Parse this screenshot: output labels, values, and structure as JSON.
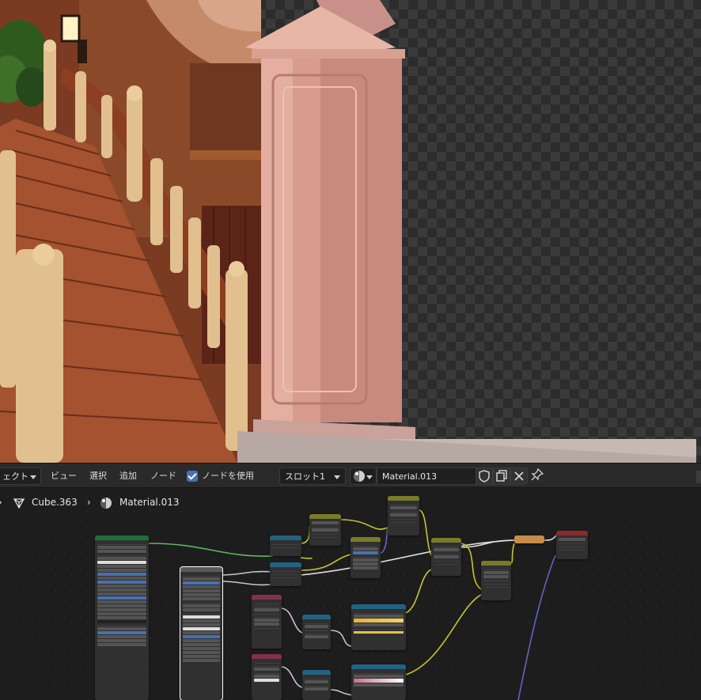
{
  "header": {
    "editor_mode": "ェクト",
    "menu": [
      "ビュー",
      "選択",
      "追加",
      "ノード"
    ],
    "use_nodes_label": "ノードを使用",
    "slot": "スロット1",
    "material_name": "Material.013"
  },
  "breadcrumb": {
    "object": "Cube.363",
    "material": "Material.013"
  },
  "colors": {
    "header_bg": "#2a2a2a",
    "node_editor_bg": "#1d1d1d",
    "shader_node_header": "#7aa12c",
    "texture_node_header": "#246283",
    "input_node_header": "#83314a",
    "converter_node_header": "#5c5c7a",
    "shader_link": "#5cb85c",
    "color_link": "#c7c729",
    "vector_link": "#6363c7",
    "float_link": "#a1a1a1",
    "checkbox_accent": "#4772b3"
  },
  "icons": [
    "dropdown-chevron",
    "checkbox-checked",
    "sphere-icon",
    "fake-user-shield-icon",
    "duplicate-icon",
    "close-icon",
    "pin-icon",
    "mesh-icon",
    "material-icon"
  ]
}
